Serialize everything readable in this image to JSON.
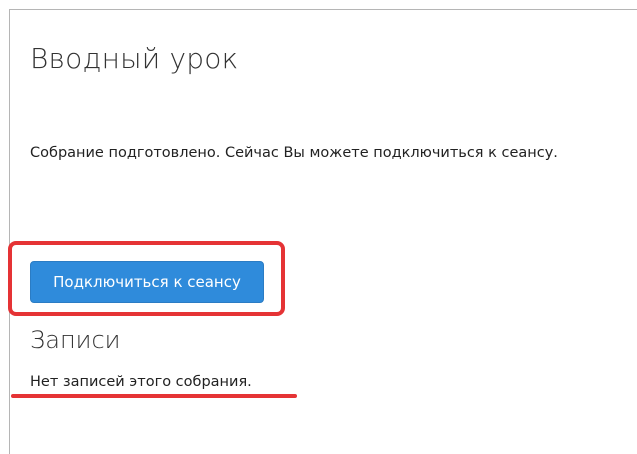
{
  "page": {
    "title": "Вводный урок",
    "status_message": "Собрание подготовлено. Сейчас Вы можете подключиться к сеансу."
  },
  "actions": {
    "join_label": "Подключиться к сеансу"
  },
  "recordings": {
    "title": "Записи",
    "empty_message": "Нет записей этого собрания."
  },
  "colors": {
    "primary_button": "#2f8bdb",
    "annotation_red": "#e53335"
  }
}
